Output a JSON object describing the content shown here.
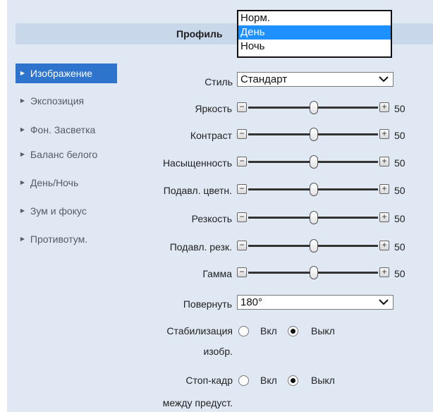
{
  "header": {
    "title": "Профиль"
  },
  "sidebar": {
    "items": [
      {
        "label": "Изображение"
      },
      {
        "label": "Экспозиция"
      },
      {
        "label": "Фон. Засветка"
      },
      {
        "label": "Баланс белого"
      },
      {
        "label": "День/Ночь"
      },
      {
        "label": "Зум и фокус"
      },
      {
        "label": "Противотум."
      }
    ],
    "active_index": 0
  },
  "profile_dropdown": {
    "options": [
      "Норм.",
      "День",
      "Ночь"
    ],
    "highlighted": "День"
  },
  "form": {
    "style": {
      "label": "Стиль",
      "value": "Стандарт"
    },
    "sliders": [
      {
        "label": "Яркость",
        "value": "50"
      },
      {
        "label": "Контраст",
        "value": "50"
      },
      {
        "label": "Насыщенность",
        "value": "50"
      },
      {
        "label": "Подавл. цветн.",
        "value": "50"
      },
      {
        "label": "Резкость",
        "value": "50"
      },
      {
        "label": "Подавл. резк.",
        "value": "50"
      },
      {
        "label": "Гамма",
        "value": "50"
      }
    ],
    "rotate": {
      "label": "Повернуть",
      "value": "180°"
    },
    "stabilization": {
      "label_line1": "Стабилизация",
      "label_line2": "изобр.",
      "on": "Вкл",
      "off": "Выкл",
      "selected": "off"
    },
    "freeze": {
      "label_line1": "Стоп-кадр",
      "label_line2": "между предуст.",
      "on": "Вкл",
      "off": "Выкл",
      "selected": "off"
    }
  },
  "colors": {
    "accent": "#2e74cc",
    "panel": "#dfe8f3",
    "header": "#c8d7ea",
    "dropdown_highlight": "#1e90ff"
  }
}
